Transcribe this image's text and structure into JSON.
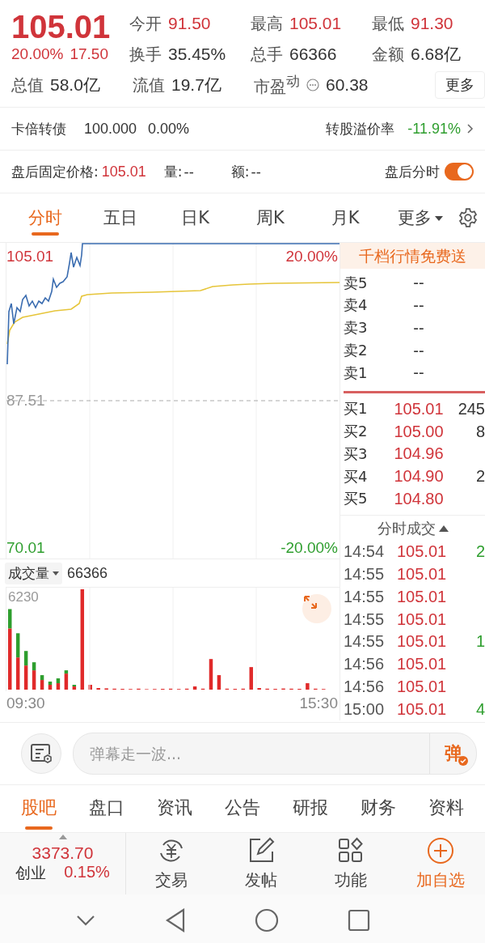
{
  "quote": {
    "price": "105.01",
    "change_pct": "20.00%",
    "change": "17.50",
    "stats": [
      {
        "label": "今开",
        "value": "91.50",
        "color": "#d0343a"
      },
      {
        "label": "最高",
        "value": "105.01",
        "color": "#d0343a"
      },
      {
        "label": "最低",
        "value": "91.30",
        "color": "#d0343a"
      },
      {
        "label": "换手",
        "value": "35.45%",
        "color": "#333333"
      },
      {
        "label": "总手",
        "value": "66366",
        "color": "#333333"
      },
      {
        "label": "金额",
        "value": "6.68亿",
        "color": "#333333"
      },
      {
        "label": "总值",
        "value": "58.0亿",
        "color": "#333333"
      },
      {
        "label": "流值",
        "value": "19.7亿",
        "color": "#333333"
      },
      {
        "label": "市盈$^{动}$",
        "value": "60.38",
        "color": "#333333"
      }
    ],
    "more_button": "更多"
  },
  "bond": {
    "name": "卡倍转债",
    "price": "100.000",
    "change": "0.00%",
    "premium_label": "转股溢价率",
    "premium": "-11.91%"
  },
  "after_hours": {
    "price_label": "盘后固定价格:",
    "price": "105.01",
    "volume_label": "量:",
    "volume": "--",
    "amount_label": "额:",
    "amount": "--",
    "toggle_label": "盘后分时",
    "toggle_on": true
  },
  "chart_tabs": [
    {
      "label": "分时",
      "selected": true,
      "kind": "tab"
    },
    {
      "label": "五日",
      "selected": false,
      "kind": "tab"
    },
    {
      "label": "日K",
      "selected": false,
      "kind": "tab"
    },
    {
      "label": "周K",
      "selected": false,
      "kind": "tab"
    },
    {
      "label": "月K",
      "selected": false,
      "kind": "tab"
    },
    {
      "label": "更多",
      "selected": false,
      "kind": "dropdown"
    }
  ],
  "price_chart": {
    "left_labels": [
      "105.01",
      "87.51",
      "70.01"
    ],
    "right_labels": [
      "20.00%",
      "-20.00%"
    ]
  },
  "volume": {
    "indicator": "成交量",
    "value": "66366",
    "max_label": "6230",
    "time_labels": [
      "09:30",
      "15:30"
    ]
  },
  "order_book": {
    "banner": "千档行情免费送",
    "asks": [
      {
        "label": "卖5",
        "price": "--"
      },
      {
        "label": "卖4",
        "price": "--"
      },
      {
        "label": "卖3",
        "price": "--"
      },
      {
        "label": "卖2",
        "price": "--"
      },
      {
        "label": "卖1",
        "price": "--"
      }
    ],
    "bids": [
      {
        "label": "买1",
        "price": "105.01",
        "volume": "245"
      },
      {
        "label": "买2",
        "price": "105.00",
        "volume": "8"
      },
      {
        "label": "买3",
        "price": "104.96"
      },
      {
        "label": "买4",
        "price": "104.90",
        "volume": "2"
      },
      {
        "label": "买5",
        "price": "104.80"
      }
    ]
  },
  "trades": {
    "title": "分时成交",
    "rows": [
      {
        "time": "14:54",
        "price": "105.01",
        "volume": "2"
      },
      {
        "time": "14:55",
        "price": "105.01"
      },
      {
        "time": "14:55",
        "price": "105.01"
      },
      {
        "time": "14:55",
        "price": "105.01"
      },
      {
        "time": "14:55",
        "price": "105.01",
        "volume": "1"
      },
      {
        "time": "14:56",
        "price": "105.01"
      },
      {
        "time": "14:56",
        "price": "105.01"
      },
      {
        "time": "15:00",
        "price": "105.01",
        "volume": "4"
      }
    ]
  },
  "barrage": {
    "placeholder": "弹幕走一波...",
    "send": "弹"
  },
  "bottom_tabs": [
    {
      "label": "股吧",
      "selected": true
    },
    {
      "label": "盘口",
      "selected": false
    },
    {
      "label": "资讯",
      "selected": false
    },
    {
      "label": "公告",
      "selected": false
    },
    {
      "label": "研报",
      "selected": false
    },
    {
      "label": "财务",
      "selected": false
    },
    {
      "label": "资料",
      "selected": false
    }
  ],
  "index": {
    "value": "3373.70",
    "name": "创业",
    "change": "0.15%"
  },
  "actions": [
    {
      "label": "交易",
      "kind": "trade",
      "highlighted": false
    },
    {
      "label": "发帖",
      "kind": "post",
      "highlighted": false
    },
    {
      "label": "功能",
      "kind": "function",
      "highlighted": false
    },
    {
      "label": "加自选",
      "kind": "add",
      "highlighted": true
    }
  ]
}
